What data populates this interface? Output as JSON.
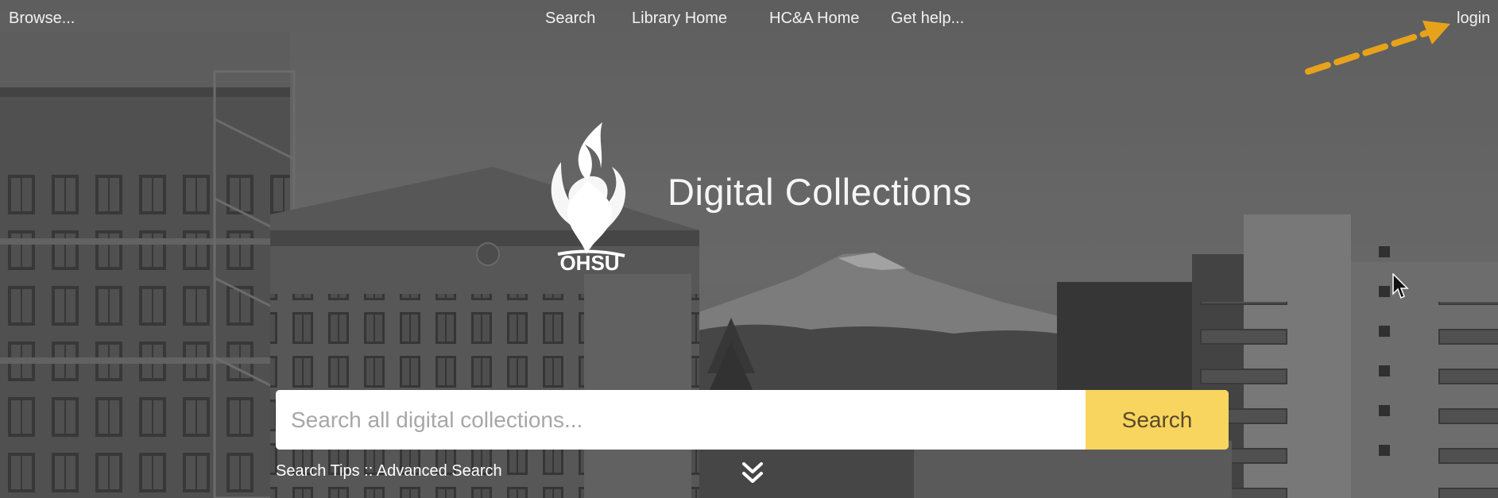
{
  "nav": {
    "browse": "Browse...",
    "search": "Search",
    "library_home": "Library Home",
    "hca_home": "HC&A Home",
    "get_help": "Get help...",
    "login": "login"
  },
  "brand": {
    "logo_text": "OHSU",
    "title": "Digital Collections"
  },
  "search": {
    "placeholder": "Search all digital collections...",
    "button_label": "Search"
  },
  "links": {
    "search_tips": "Search Tips",
    "separator": " :: ",
    "advanced_search": "Advanced Search"
  },
  "icons": {
    "scroll": "double-chevron-down-icon",
    "annotation": "dashed-arrow-annotation",
    "cursor": "mouse-pointer-icon"
  },
  "colors": {
    "search_button": "#f8d55f",
    "annotation_arrow": "#e8a21a",
    "text": "#ffffff"
  }
}
